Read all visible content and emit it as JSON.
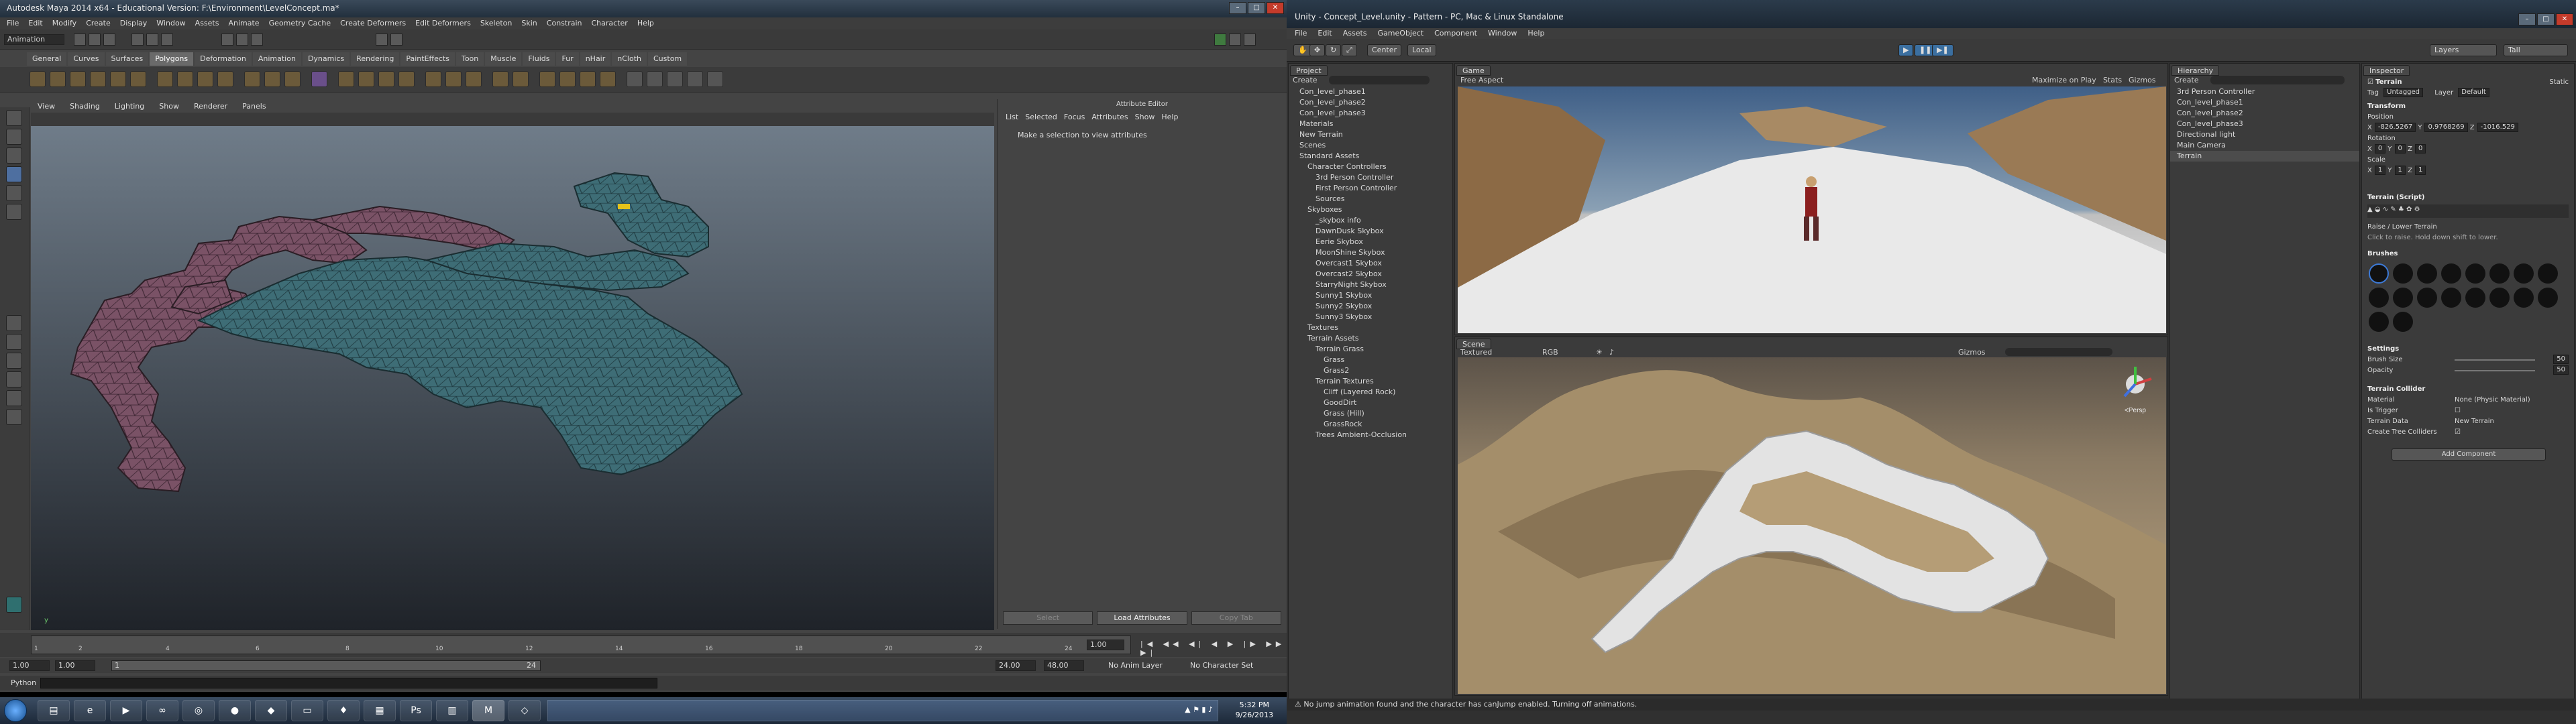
{
  "maya": {
    "title": "Autodesk Maya 2014 x64 - Educational Version: F:\\Environment\\LevelConcept.ma*",
    "menu": [
      "File",
      "Edit",
      "Modify",
      "Create",
      "Display",
      "Window",
      "Assets",
      "Animate",
      "Geometry Cache",
      "Create Deformers",
      "Edit Deformers",
      "Skeleton",
      "Skin",
      "Constrain",
      "Character",
      "Help"
    ],
    "mode": "Animation",
    "shelf_tabs": [
      "General",
      "Curves",
      "Surfaces",
      "Polygons",
      "Deformation",
      "Animation",
      "Dynamics",
      "Rendering",
      "PaintEffects",
      "Toon",
      "Muscle",
      "Fluids",
      "Fur",
      "nHair",
      "nCloth",
      "Custom"
    ],
    "active_shelf": "Polygons",
    "panel_menu": [
      "View",
      "Shading",
      "Lighting",
      "Show",
      "Renderer",
      "Panels"
    ],
    "attr_editor": {
      "header": "Attribute Editor",
      "menu": [
        "List",
        "Selected",
        "Focus",
        "Attributes",
        "Show",
        "Help"
      ],
      "message": "Make a selection to view attributes",
      "buttons": [
        "Select",
        "Load Attributes",
        "Copy Tab"
      ]
    },
    "timeline": {
      "ticks": [
        "1",
        "2",
        "4",
        "6",
        "8",
        "10",
        "12",
        "14",
        "16",
        "18",
        "20",
        "22",
        "24"
      ],
      "current_frame": "1.00"
    },
    "range": {
      "start": "1.00",
      "anim_start": "1.00",
      "slider_start": "1",
      "slider_end": "24",
      "end1": "24.00",
      "end2": "48.00",
      "anim_layer": "No Anim Layer",
      "char_set": "No Character Set"
    },
    "python_label": "Python"
  },
  "unity": {
    "title": "Unity - Concept_Level.unity - Pattern - PC, Mac & Linux Standalone",
    "menu": [
      "File",
      "Edit",
      "Assets",
      "GameObject",
      "Component",
      "Window",
      "Help"
    ],
    "toolbar": {
      "pivot": "Center",
      "space": "Local",
      "layers": "Layers",
      "layout": "Tall"
    },
    "project": {
      "tab": "Project",
      "create": "Create",
      "items": [
        "Con_level_phase1",
        "Con_level_phase2",
        "Con_level_phase3",
        "Materials",
        "New Terrain",
        "Scenes",
        "Standard Assets",
        "Character Controllers",
        "3rd Person Controller",
        "First Person Controller",
        "Sources",
        "Skyboxes",
        "_skybox info",
        "DawnDusk Skybox",
        "Eerie Skybox",
        "MoonShine Skybox",
        "Overcast1 Skybox",
        "Overcast2 Skybox",
        "StarryNight Skybox",
        "Sunny1 Skybox",
        "Sunny2 Skybox",
        "Sunny3 Skybox",
        "Textures",
        "Terrain Assets",
        "Terrain Grass",
        "Grass",
        "Grass2",
        "Terrain Textures",
        "Cliff (Layered Rock)",
        "GoodDirt",
        "Grass (Hill)",
        "GrassRock",
        "Trees Ambient-Occlusion"
      ]
    },
    "game": {
      "tab": "Game",
      "aspect": "Free Aspect",
      "options": [
        "Maximize on Play",
        "Stats",
        "Gizmos"
      ]
    },
    "scene": {
      "tab": "Scene",
      "mode": "Textured",
      "color": "RGB",
      "gizmos": "Gizmos",
      "view_label": "<Persp"
    },
    "hierarchy": {
      "tab": "Hierarchy",
      "create": "Create",
      "items": [
        "3rd Person Controller",
        "Con_level_phase1",
        "Con_level_phase2",
        "Con_level_phase3",
        "Directional light",
        "Main Camera",
        "Terrain"
      ],
      "selected": "Terrain"
    },
    "inspector": {
      "tab": "Inspector",
      "object": "Terrain",
      "static": "Static",
      "tag_label": "Tag",
      "tag": "Untagged",
      "layer_label": "Layer",
      "layer": "Default",
      "transform": "Transform",
      "position": {
        "label": "Position",
        "x": "-826.5267",
        "y": "0.9768269",
        "z": "-1016.529"
      },
      "rotation": {
        "label": "Rotation",
        "x": "0",
        "y": "0",
        "z": "0"
      },
      "scale": {
        "label": "Scale",
        "x": "1",
        "y": "1",
        "z": "1"
      },
      "terrain_script": "Terrain (Script)",
      "tool_title": "Raise / Lower Terrain",
      "tool_hint": "Click to raise. Hold down shift to lower.",
      "brushes": "Brushes",
      "settings": "Settings",
      "brush_size": {
        "label": "Brush Size",
        "value": "50"
      },
      "opacity": {
        "label": "Opacity",
        "value": "50"
      },
      "collider": "Terrain Collider",
      "material": {
        "label": "Material",
        "value": "None (Physic Material)"
      },
      "is_trigger": "Is Trigger",
      "terrain_data": {
        "label": "Terrain Data",
        "value": "New Terrain"
      },
      "create_tree": "Create Tree Colliders",
      "add_component": "Add Component"
    },
    "status": "No jump animation found and the character has canJump enabled. Turning off animations."
  },
  "taskbar": {
    "time": "5:32 PM",
    "date": "9/26/2013"
  },
  "colors": {
    "maya_bg": "#444444",
    "unity_bg": "#303030",
    "pink_tiles": "#7a5266",
    "teal_tiles": "#3e6d76",
    "terrain": "#c3ab86"
  }
}
